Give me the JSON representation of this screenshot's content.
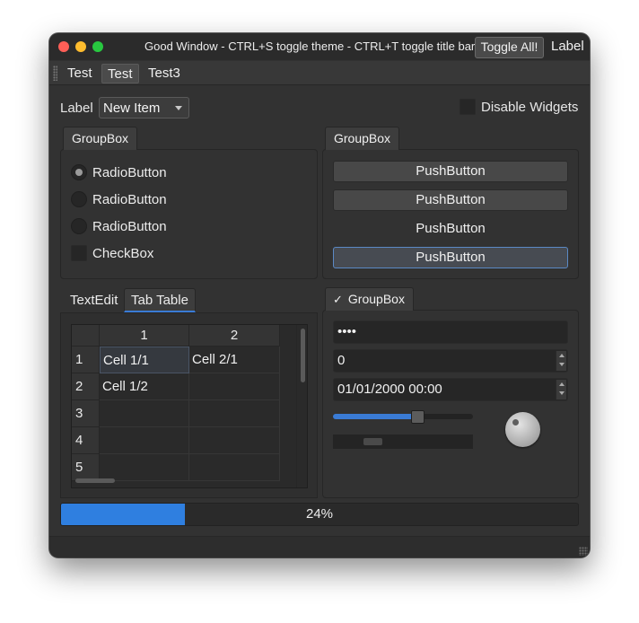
{
  "window": {
    "title": "Good Window - CTRL+S toggle theme - CTRL+T toggle title bar!",
    "toggle_button": "Toggle All!",
    "title_label": "Label"
  },
  "menubar": {
    "items": [
      {
        "label": "Test"
      },
      {
        "label": "Test"
      },
      {
        "label": "Test3"
      }
    ]
  },
  "top_row": {
    "label": "Label",
    "combo_value": "New Item",
    "disable_label": "Disable Widgets"
  },
  "groupbox_left": {
    "title": "GroupBox",
    "radios": [
      {
        "label": "RadioButton",
        "checked": true
      },
      {
        "label": "RadioButton",
        "checked": false
      },
      {
        "label": "RadioButton",
        "checked": false
      }
    ],
    "checkbox_label": "CheckBox"
  },
  "groupbox_right": {
    "title": "GroupBox",
    "buttons": [
      "PushButton",
      "PushButton",
      "PushButton",
      "PushButton"
    ]
  },
  "tabs": {
    "items": [
      "TextEdit",
      "Tab Table"
    ],
    "active": 1
  },
  "table": {
    "columns": [
      "1",
      "2"
    ],
    "rows": [
      "1",
      "2",
      "3",
      "4",
      "5"
    ],
    "cells": [
      [
        "Cell 1/1",
        "Cell 2/1"
      ],
      [
        "Cell 1/2",
        ""
      ],
      [
        "",
        ""
      ],
      [
        "",
        ""
      ],
      [
        "",
        ""
      ]
    ]
  },
  "groupbox_inputs": {
    "title": "GroupBox",
    "check_mark": "✓",
    "password": "••••",
    "spin_value": "0",
    "datetime": "01/01/2000 00:00",
    "slider_value": 0.6
  },
  "progress": {
    "value": 0.24,
    "text": "24%",
    "color": "#2f7fe0"
  },
  "colors": {
    "accent": "#3a7bd5",
    "window_bg": "#323232"
  }
}
